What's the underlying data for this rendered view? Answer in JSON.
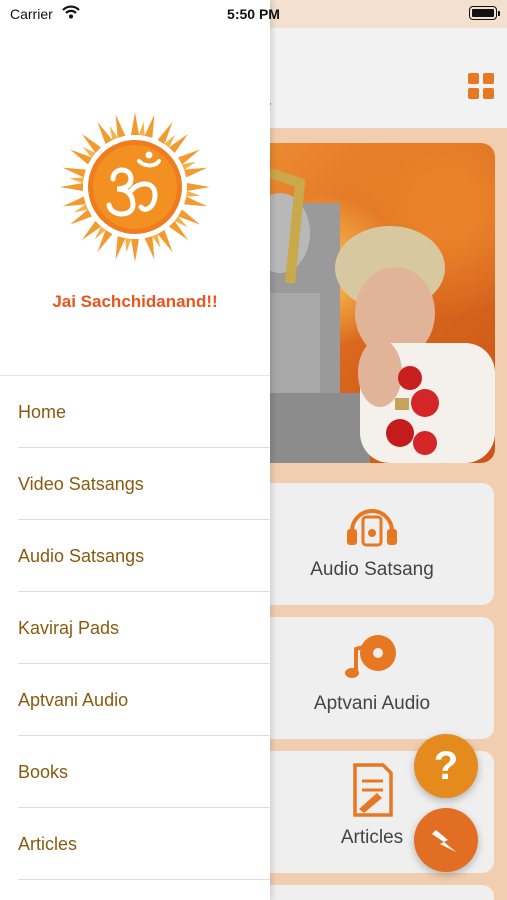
{
  "status_bar": {
    "carrier": "Carrier",
    "time": "5:50 PM"
  },
  "main": {
    "title_partial": "ush",
    "cards": [
      {
        "label": "Audio Satsang",
        "icon": "headphones-icon"
      },
      {
        "label": "Aptvani Audio",
        "icon": "music-disc-icon"
      },
      {
        "label": "Articles",
        "icon": "document-pen-icon"
      }
    ],
    "help_fab": {
      "symbol": "?"
    },
    "bolt_fab": {
      "icon": "lightning-icon"
    }
  },
  "drawer": {
    "logo": "om-sun-logo",
    "greeting": "Jai Sachchidanand!!",
    "menu": [
      {
        "label": "Home"
      },
      {
        "label": "Video Satsangs"
      },
      {
        "label": "Audio Satsangs"
      },
      {
        "label": "Kaviraj Pads"
      },
      {
        "label": "Aptvani Audio"
      },
      {
        "label": "Books"
      },
      {
        "label": "Articles"
      }
    ]
  },
  "colors": {
    "accent": "#e87722",
    "greeting": "#e8551e",
    "menu_text": "#8a5a10",
    "fab": "#e58b1d"
  }
}
